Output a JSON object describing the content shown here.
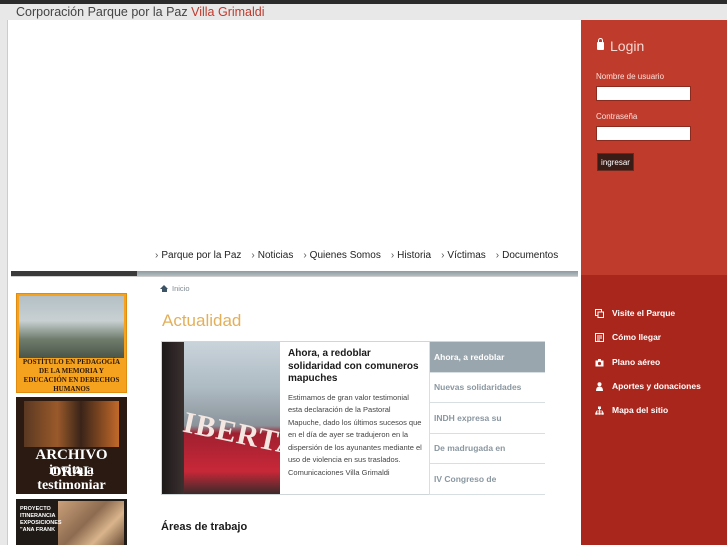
{
  "header": {
    "title_main": "Corporación Parque por la Paz ",
    "title_accent": "Villa Grimaldi"
  },
  "nav": [
    "Parque por la Paz",
    "Noticias",
    "Quienes Somos",
    "Historia",
    "Víctimas",
    "Documentos"
  ],
  "breadcrumb": "Inicio",
  "section_title": "Actualidad",
  "featured": {
    "headline": "Ahora, a redoblar solidaridad con comuneros mapuches",
    "body": "Estimamos de gran valor testimonial esta declaración de la Pastoral Mapuche, dado los últimos sucesos que en el día de ayer se tradujeron en la dispersión de los ayunantes mediante el uso de violencia en sus traslados. Comunicaciones Villa Grimaldi",
    "image_text": "IBERTAD"
  },
  "news_tabs": [
    "Ahora, a redoblar",
    "Nuevas solidaridades",
    "INDH expresa su",
    "De madrugada en",
    "IV Congreso de"
  ],
  "areas_title": "Áreas de trabajo",
  "login": {
    "title": "Login",
    "username_label": "Nombre de usuario",
    "password_label": "Contraseña",
    "submit": "ingresar"
  },
  "side_links": [
    {
      "label": "Visite el Parque",
      "icon": "square-icon"
    },
    {
      "label": "Cómo llegar",
      "icon": "map-icon"
    },
    {
      "label": "Plano aéreo",
      "icon": "camera-icon"
    },
    {
      "label": "Aportes y donaciones",
      "icon": "person-icon"
    },
    {
      "label": "Mapa del sitio",
      "icon": "sitemap-icon"
    }
  ],
  "banners": {
    "pedagogia": "POSTÍTULO EN PEDAGOGÍA DE LA MEMORIA Y EDUCACIÓN EN DERECHOS HUMANOS",
    "archivo_1": "ARCHIVO ORAL",
    "archivo_2": "invita a testimoniar",
    "proyecto": "PROYECTO ITINERANCIA EXPOSICIONES \"ANA FRANK"
  },
  "colors": {
    "accent": "#c0392b",
    "login_bg": "#bf3b2c",
    "links_bg": "#a8261c",
    "section_title": "#e3b05a",
    "active_tab": "#9aa6ad"
  }
}
